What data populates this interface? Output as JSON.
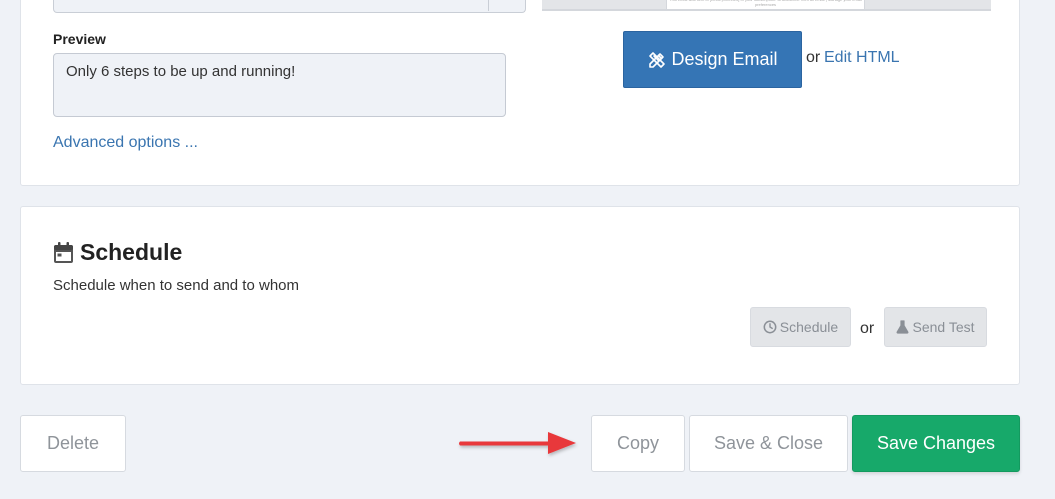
{
  "preview": {
    "label": "Preview",
    "value": "Only 6 steps to be up and running!"
  },
  "advanced_options": "Advanced options ...",
  "design": {
    "button_label": "Design Email",
    "or": "or",
    "edit_html": "Edit HTML",
    "thumbnail_text": "This email was sent to [email protected] of your subscription. Unsubscribe from all email | Manage your email preferences"
  },
  "schedule": {
    "title": "Schedule",
    "description": "Schedule when to send and to whom",
    "schedule_button": "Schedule",
    "or": "or",
    "send_test_button": "Send Test"
  },
  "footer": {
    "delete": "Delete",
    "copy": "Copy",
    "save_close": "Save & Close",
    "save_changes": "Save Changes"
  },
  "colors": {
    "primary": "#3575b5",
    "success": "#17a96a",
    "link": "#3a75b0",
    "arrow": "#e8373a",
    "background": "#eff2f7"
  },
  "icons": {
    "design": "pencil-ruler-icon",
    "schedule_heading": "calendar-icon",
    "schedule_button": "clock-icon",
    "send_test": "flask-icon",
    "annotation": "red-arrow-icon"
  }
}
